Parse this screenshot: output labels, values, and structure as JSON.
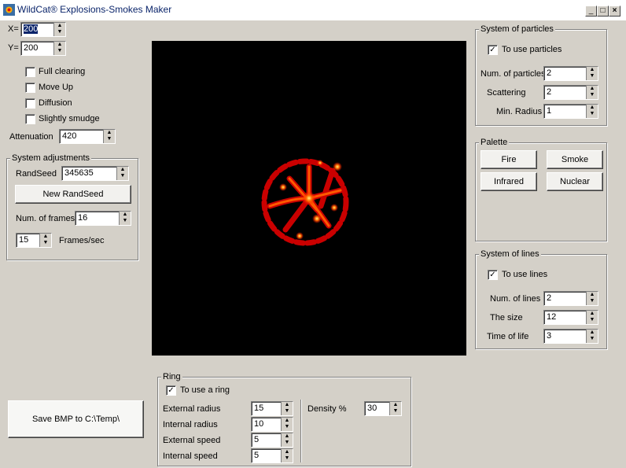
{
  "window": {
    "title": "WildCat® Explosions-Smokes Maker",
    "min": "_",
    "max": "□",
    "close": "×"
  },
  "coords": {
    "x_label": "X=",
    "x_value": "200",
    "y_label": "Y=",
    "y_value": "200"
  },
  "options": {
    "full_clearing": "Full clearing",
    "move_up": "Move Up",
    "diffusion": "Diffusion",
    "slightly_smudge": "Slightly smudge"
  },
  "attenuation": {
    "label": "Attenuation",
    "value": "420"
  },
  "system_adjustments": {
    "title": "System adjustments",
    "randseed_label": "RandSeed",
    "randseed_value": "345635",
    "new_randseed": "New RandSeed",
    "frames_label": "Num. of frames",
    "frames_value": "16",
    "fps_value": "15",
    "fps_label": "Frames/sec"
  },
  "save_button": "Save BMP to C:\\Temp\\",
  "particles": {
    "title": "System of particles",
    "use_label": "To use particles",
    "use_checked": "✓",
    "num_label": "Num. of particles",
    "num_value": "2",
    "scatter_label": "Scattering",
    "scatter_value": "2",
    "minr_label": "Min. Radius",
    "minr_value": "1"
  },
  "palette": {
    "title": "Palette",
    "fire": "Fire",
    "smoke": "Smoke",
    "infrared": "Infrared",
    "nuclear": "Nuclear"
  },
  "lines": {
    "title": "System of lines",
    "use_label": "To use lines",
    "use_checked": "✓",
    "num_label": "Num. of lines",
    "num_value": "2",
    "size_label": "The size",
    "size_value": "12",
    "life_label": "Time of life",
    "life_value": "3"
  },
  "ring": {
    "title": "Ring",
    "use_label": "To use a ring",
    "use_checked": "✓",
    "ext_r_label": "External radius",
    "ext_r_value": "15",
    "int_r_label": "Internal radius",
    "int_r_value": "10",
    "ext_s_label": "External speed",
    "ext_s_value": "5",
    "int_s_label": "Internal speed",
    "int_s_value": "5",
    "density_label": "Density %",
    "density_value": "30"
  },
  "spin_arrows": {
    "up": "▲",
    "down": "▼"
  }
}
